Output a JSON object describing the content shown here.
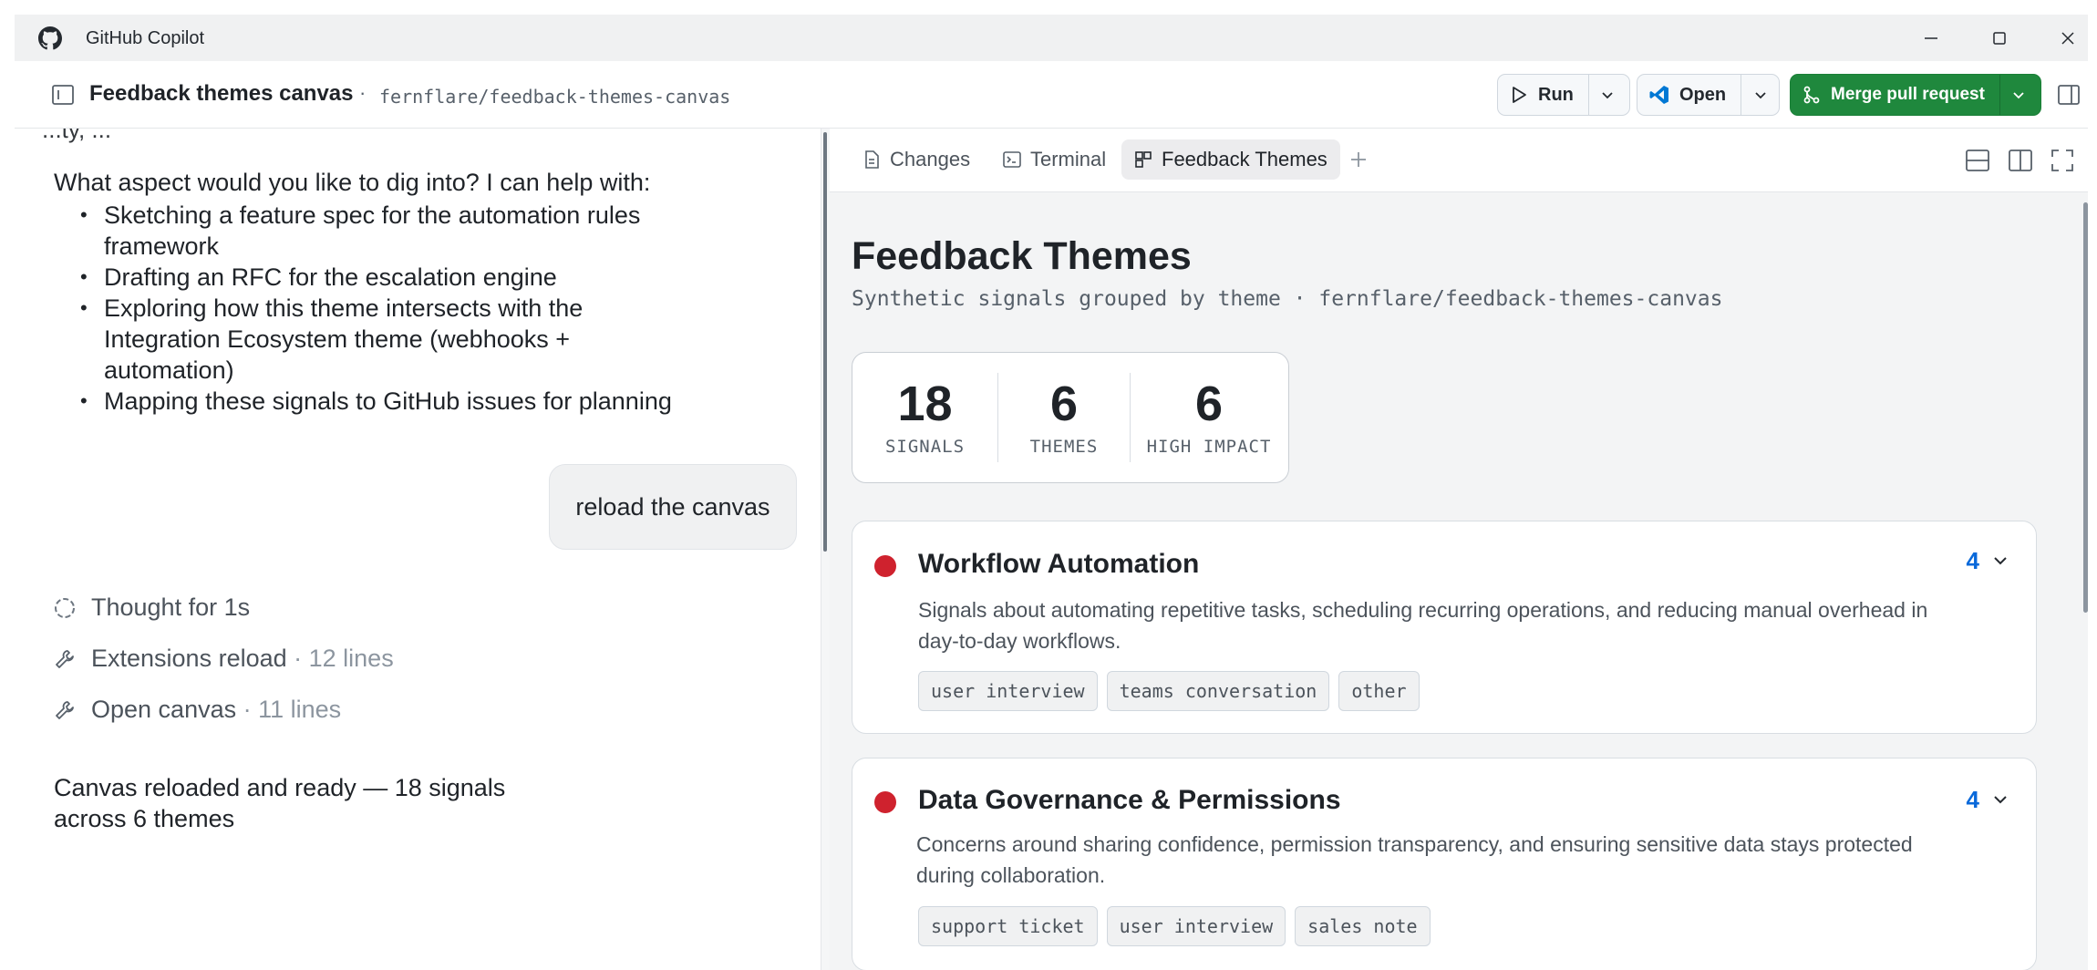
{
  "window": {
    "app_title": "GitHub Copilot"
  },
  "header": {
    "title": "Feedback themes canvas",
    "separator": "·",
    "branch": "fernflare/feedback-themes-canvas",
    "run_label": "Run",
    "open_label": "Open",
    "merge_label": "Merge pull request"
  },
  "chat": {
    "cut_text": "...ty,                    ...",
    "question": "What aspect would you like to dig into? I can help with:",
    "bullets": [
      "Sketching a feature spec for the automation rules framework",
      "Drafting an RFC for the escalation engine",
      "Exploring how this theme intersects with the Integration Ecosystem theme (webhooks + automation)",
      "Mapping these signals to GitHub issues for planning"
    ],
    "user_message": "reload the canvas",
    "steps": [
      {
        "label": "Thought for 1s",
        "detail": ""
      },
      {
        "label": "Extensions reload",
        "detail": " · 12 lines"
      },
      {
        "label": "Open canvas",
        "detail": " · 11 lines"
      }
    ],
    "answer": "Canvas reloaded and ready — 18 signals across 6 themes"
  },
  "tabs": [
    {
      "label": "Changes",
      "icon": "file-diff-icon"
    },
    {
      "label": "Terminal",
      "icon": "terminal-icon"
    },
    {
      "label": "Feedback Themes",
      "icon": "canvas-icon",
      "active": true
    }
  ],
  "canvas": {
    "title": "Feedback Themes",
    "subtitle": "Synthetic signals grouped by theme · fernflare/feedback-themes-canvas",
    "stats": [
      {
        "value": "18",
        "label": "SIGNALS"
      },
      {
        "value": "6",
        "label": "THEMES"
      },
      {
        "value": "6",
        "label": "HIGH IMPACT"
      }
    ],
    "themes": [
      {
        "name": "Workflow Automation",
        "count": "4",
        "description": "Signals about automating repetitive tasks, scheduling recurring operations, and reducing manual overhead in day-to-day workflows.",
        "tags": [
          "user interview",
          "teams conversation",
          "other"
        ],
        "impact_color": "#cf222e"
      },
      {
        "name": "Data Governance & Permissions",
        "count": "4",
        "description": "Concerns around sharing confidence, permission transparency, and ensuring sensitive data stays protected during collaboration.",
        "tags": [
          "support ticket",
          "user interview",
          "sales note"
        ],
        "impact_color": "#cf222e"
      }
    ]
  },
  "colors": {
    "accent_green": "#1f883d",
    "link_blue": "#0969da",
    "high_impact_red": "#cf222e"
  }
}
